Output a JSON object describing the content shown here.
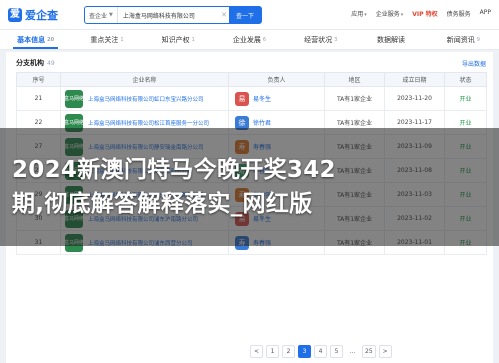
{
  "header": {
    "logo_mark": "爱",
    "logo_text": "爱企查",
    "search_scope": "查企业",
    "search_value": "上海盒马网络科技有限公司",
    "search_button": "查一下",
    "nav": [
      "应用",
      "企业服务",
      "VIP 特权",
      "债务服务",
      "APP"
    ]
  },
  "tabs": [
    {
      "label": "基本信息",
      "count": "20"
    },
    {
      "label": "重点关注",
      "count": "1"
    },
    {
      "label": "知识产权",
      "count": "1"
    },
    {
      "label": "企业发展",
      "count": "6"
    },
    {
      "label": "经营状况",
      "count": "3"
    },
    {
      "label": "数据解读",
      "count": ""
    },
    {
      "label": "新闻资讯",
      "count": "9"
    }
  ],
  "section": {
    "title": "分支机构",
    "count": "49",
    "export": "导出数据"
  },
  "table": {
    "headers": [
      "序号",
      "企业名称",
      "负责人",
      "地区",
      "成立日期",
      "状态"
    ],
    "rows": [
      {
        "no": "21",
        "company": "上海盒马网络科技有限公司虹口东宝兴路分公司",
        "logo": "盒马网络",
        "avatar": "易",
        "person": "易冬生",
        "region": "TA有1家企业",
        "date": "2023-11-20",
        "status": "开业",
        "avatar_color": "#d9534f"
      },
      {
        "no": "22",
        "company": "上海盒马网络科技有限公司松江首座服务一分公司",
        "logo": "盒马网络",
        "avatar": "徐",
        "person": "徐竹君",
        "region": "TA有1家企业",
        "date": "2023-11-17",
        "status": "开业",
        "avatar_color": "#3a7bd5"
      },
      {
        "no": "27",
        "company": "上海盒马网络科技有限公司静安瑞金南路分公司",
        "logo": "盒马网络",
        "avatar": "寿",
        "person": "寿春强",
        "region": "TA有1家企业",
        "date": "2023-11-09",
        "status": "开业",
        "avatar_color": "#e07a2f"
      },
      {
        "no": "28",
        "company": "上海盒马网络科技有限公司浦东保利分公司",
        "logo": "盒马网络",
        "avatar": "寿",
        "person": "寿春强",
        "region": "TA有1家企业",
        "date": "2023-11-08",
        "status": "开业",
        "avatar_color": "#3aa66a"
      },
      {
        "no": "29",
        "company": "上海盒马网络科技有限公司浦东沪南公路分公司",
        "logo": "盒马网络",
        "avatar": "寿",
        "person": "寿春强",
        "region": "TA有1家企业",
        "date": "2023-11-03",
        "status": "开业",
        "avatar_color": "#e07a2f"
      },
      {
        "no": "30",
        "company": "上海盒马网络科技有限公司浦东沪南路分公司",
        "logo": "盒马网络",
        "avatar": "易",
        "person": "易冬生",
        "region": "TA有1家企业",
        "date": "2023-11-02",
        "status": "开业",
        "avatar_color": "#d9534f"
      },
      {
        "no": "31",
        "company": "上海盒马网络科技有限公司浦东西营分公司",
        "logo": "盒马网络",
        "avatar": "寿",
        "person": "寿春强",
        "region": "TA有1家企业",
        "date": "2023-11-01",
        "status": "开业",
        "avatar_color": "#3a7bd5"
      }
    ]
  },
  "overlay": {
    "line1": "2024新澳门特马今晚开奖342",
    "line2": "期,彻底解答解释落实_网红版"
  },
  "pagination": [
    "<",
    "1",
    "2",
    "3",
    "4",
    "5",
    "...",
    "25",
    ">"
  ],
  "pagination_active": "3"
}
